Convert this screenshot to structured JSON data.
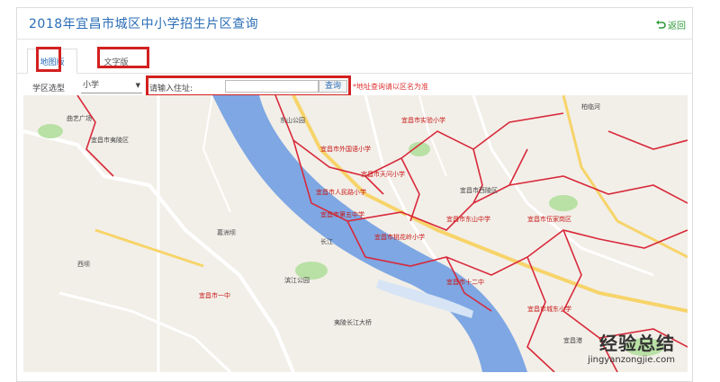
{
  "header": {
    "title": "2018年宜昌市城区中小学招生片区查询",
    "back_label": "返回"
  },
  "tabs": [
    {
      "label": "地图版"
    },
    {
      "label": "文字版"
    }
  ],
  "filters": {
    "type_label": "学区选型",
    "stage_value": "小学",
    "address_label": "请输入住址:",
    "address_value": "",
    "query_label": "查询",
    "note": "*地址查询请以区名为准"
  },
  "map": {
    "labels": [
      "曲艺广场",
      "宜昌市夷陵区",
      "东山公园",
      "宜昌市实验小学",
      "宜昌市外国语小学",
      "宜昌市天问小学",
      "宜昌市人民路小学",
      "宜昌市西陵区",
      "滨江公园",
      "宜昌市第五中学",
      "宜昌市东山中学",
      "宜昌市伍家岗区",
      "柏临河",
      "宜昌市桃花岭小学",
      "宜昌市十二中",
      "长江",
      "西坝",
      "夷陵长江大桥",
      "葛洲坝",
      "宜昌市城东小学",
      "宜昌市一中",
      "宜昌港"
    ]
  },
  "watermark": {
    "cn": "经验总结",
    "url": "jingyanzongjie.com"
  },
  "colors": {
    "title": "#2a6db6",
    "highlight": "#d32020",
    "river": "#7ea7e3",
    "boundary": "#d8293a"
  }
}
